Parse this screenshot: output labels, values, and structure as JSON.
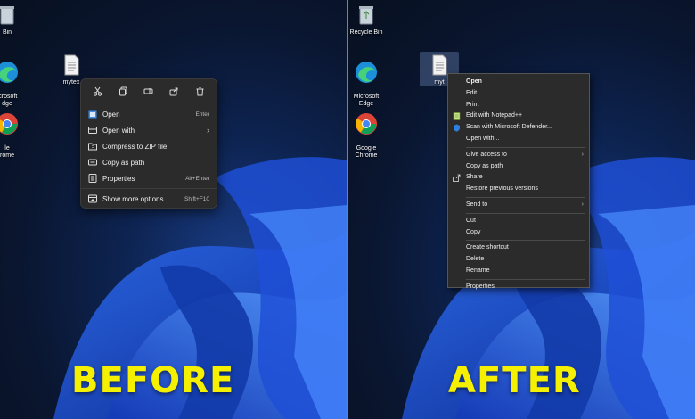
{
  "left": {
    "desktop_icons": [
      {
        "label": "Bin",
        "icon": "recycle-bin-icon"
      },
      {
        "label": "icrosoft\ndge",
        "icon": "edge-icon"
      },
      {
        "label": "le\nrome",
        "icon": "chrome-icon"
      },
      {
        "label": "mytex",
        "icon": "text-file-icon"
      }
    ],
    "menu": {
      "toolbar": [
        "cut-icon",
        "copy-icon",
        "rename-icon",
        "share-icon",
        "delete-icon"
      ],
      "items": [
        {
          "label": "Open",
          "shortcut": "Enter",
          "icon": "open-icon"
        },
        {
          "label": "Open with",
          "shortcut": "›",
          "icon": "open-with-icon"
        },
        {
          "label": "Compress to ZIP file",
          "shortcut": "",
          "icon": "zip-icon"
        },
        {
          "label": "Copy as path",
          "shortcut": "",
          "icon": "copy-path-icon"
        },
        {
          "label": "Properties",
          "shortcut": "Alt+Enter",
          "icon": "properties-icon"
        },
        {
          "label": "Show more options",
          "shortcut": "Shift+F10",
          "icon": "more-options-icon"
        }
      ]
    },
    "caption": "BEFORE"
  },
  "right": {
    "desktop_icons": [
      {
        "label": "Recycle Bin",
        "icon": "recycle-bin-icon"
      },
      {
        "label": "Microsoft\nEdge",
        "icon": "edge-icon"
      },
      {
        "label": "Google\nChrome",
        "icon": "chrome-icon"
      },
      {
        "label": "myt",
        "icon": "text-file-icon"
      }
    ],
    "menu": {
      "groups": [
        [
          {
            "label": "Open",
            "bold": true
          },
          {
            "label": "Edit"
          },
          {
            "label": "Print"
          },
          {
            "label": "Edit with Notepad++",
            "icon": "notepad-plus-icon"
          },
          {
            "label": "Scan with Microsoft Defender...",
            "icon": "defender-icon"
          },
          {
            "label": "Open with..."
          }
        ],
        [
          {
            "label": "Give access to",
            "submenu": true
          },
          {
            "label": "Copy as path"
          },
          {
            "label": "Share",
            "icon": "share-icon"
          },
          {
            "label": "Restore previous versions"
          }
        ],
        [
          {
            "label": "Send to",
            "submenu": true
          }
        ],
        [
          {
            "label": "Cut"
          },
          {
            "label": "Copy"
          }
        ],
        [
          {
            "label": "Create shortcut"
          },
          {
            "label": "Delete"
          },
          {
            "label": "Rename"
          }
        ],
        [
          {
            "label": "Properties"
          }
        ]
      ]
    },
    "caption": "AFTER"
  },
  "colors": {
    "caption": "#f5f000",
    "divider": "#1fbf3a",
    "menu_bg": "#2b2b2b",
    "accent": "#3b8eea"
  }
}
